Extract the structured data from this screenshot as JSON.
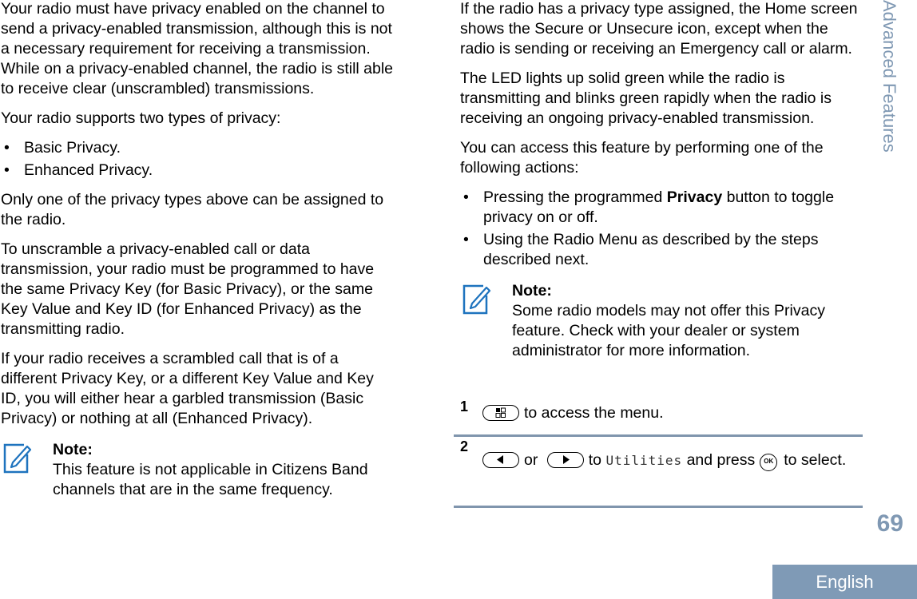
{
  "left_column": {
    "para1": "Your radio must have privacy enabled on the channel to send a privacy-enabled transmission, although this is not a necessary requirement for receiving a transmission. While on a privacy-enabled channel, the radio is still able to receive clear (unscrambled) transmissions.",
    "para2": "Your radio supports two types of privacy:",
    "privacy_types": [
      "Basic Privacy.",
      "Enhanced Privacy."
    ],
    "para3": "Only one of the privacy types above can be assigned to the radio.",
    "para4": "To unscramble a privacy-enabled call or data transmission, your radio must be programmed to have the same Privacy Key (for Basic Privacy), or the same Key Value and Key ID (for Enhanced Privacy) as the transmitting radio.",
    "para5": "If your radio receives a scrambled call that is of a different Privacy Key, or a different Key Value and Key ID, you will either hear a garbled transmission (Basic Privacy) or nothing at all (Enhanced Privacy).",
    "note": {
      "icon": "note-pencil-icon",
      "title": "Note:",
      "text": "This feature is not applicable in Citizens Band channels that are in the same frequency."
    }
  },
  "right_column": {
    "para1": "If the radio has a privacy type assigned, the Home screen shows the Secure or Unsecure icon, except when the radio is sending or receiving an Emergency call or alarm.",
    "para2": "The LED lights up solid green while the radio is transmitting and blinks green rapidly when the radio is receiving an ongoing privacy-enabled transmission.",
    "para3": "You can access this feature by performing one of the following actions:",
    "actions": [
      {
        "before": "Pressing the programmed ",
        "bold": "Privacy",
        "after": " button to toggle privacy on or off."
      },
      {
        "before": "Using the Radio Menu as described by the steps described next.",
        "bold": "",
        "after": ""
      }
    ],
    "note": {
      "icon": "note-pencil-icon",
      "title": "Note:",
      "text": "Some radio models may not offer this Privacy feature. Check with your dealer or system administrator for more information."
    }
  },
  "steps": [
    {
      "number": "1",
      "key_icon": "menu-key-icon",
      "text": "to access the menu."
    },
    {
      "number": "2",
      "key_left_icon": "left-arrow-key-icon",
      "or": "or",
      "key_right_icon": "right-arrow-key-icon",
      "to": "to",
      "menu_item": "Utilities",
      "and_press": "and press",
      "ok_label": "OK",
      "tail": "to select."
    }
  ],
  "sidebar": {
    "section_title": "Advanced Features",
    "page_number": "69",
    "language": "English"
  },
  "colors": {
    "accent": "#7f98b3",
    "icon_blue": "#1e73be",
    "divider": "#8095ad"
  }
}
